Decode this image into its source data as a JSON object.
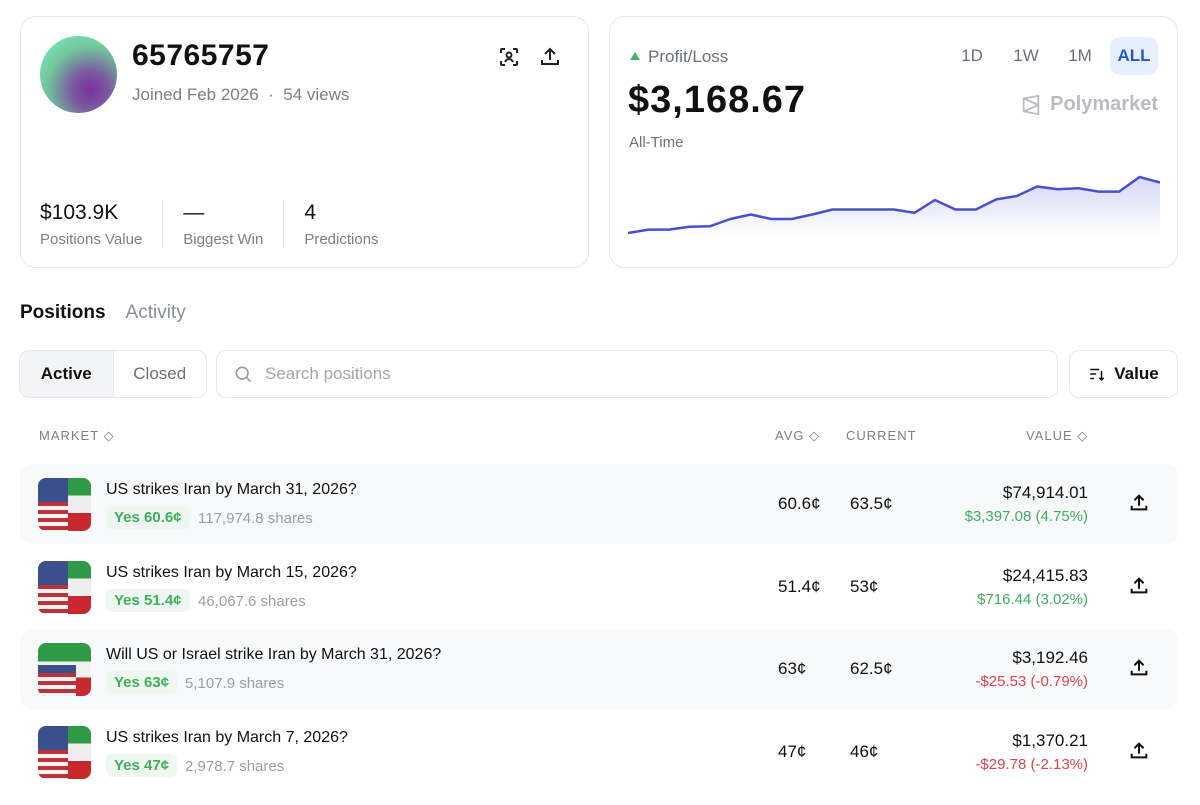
{
  "profile": {
    "username": "65765757",
    "joined": "Joined Feb 2026",
    "views": "54 views",
    "separator": "·",
    "stats": [
      {
        "value": "$103.9K",
        "label": "Positions Value"
      },
      {
        "value": "—",
        "label": "Biggest Win"
      },
      {
        "value": "4",
        "label": "Predictions"
      }
    ]
  },
  "pnl": {
    "label": "Profit/Loss",
    "value": "$3,168.67",
    "period": "All-Time",
    "ranges": [
      "1D",
      "1W",
      "1M",
      "ALL"
    ],
    "selected_range": "ALL",
    "brand": "Polymarket",
    "line_color": "#4a4fd0"
  },
  "chart_data": {
    "type": "area",
    "title": "Profit/Loss All-Time",
    "xlabel": "",
    "ylabel": "",
    "values": [
      0,
      6,
      6,
      11,
      12,
      25,
      33,
      25,
      25,
      33,
      42,
      42,
      42,
      42,
      36,
      59,
      42,
      42,
      60,
      66,
      83,
      78,
      80,
      74,
      74,
      100,
      90
    ]
  },
  "tabs": [
    "Positions",
    "Activity"
  ],
  "filter": {
    "segments": [
      "Active",
      "Closed"
    ],
    "search_placeholder": "Search positions",
    "sort_label": "Value"
  },
  "table": {
    "headers": {
      "market": "MARKET",
      "avg": "AVG",
      "current": "CURRENT",
      "value": "VALUE"
    },
    "rows": [
      {
        "title": "US strikes Iran by March 31, 2026?",
        "outcome": "Yes 60.6¢",
        "shares": "117,974.8 shares",
        "avg": "60.6¢",
        "current": "63.5¢",
        "value": "$74,914.01",
        "change": "$3,397.08 (4.75%)",
        "direction": "up",
        "flag": "us-iran"
      },
      {
        "title": "US strikes Iran by March 15, 2026?",
        "outcome": "Yes 51.4¢",
        "shares": "46,067.6 shares",
        "avg": "51.4¢",
        "current": "53¢",
        "value": "$24,415.83",
        "change": "$716.44 (3.02%)",
        "direction": "up",
        "flag": "us-iran"
      },
      {
        "title": "Will US or Israel strike Iran by March 31, 2026?",
        "outcome": "Yes 63¢",
        "shares": "5,107.9 shares",
        "avg": "63¢",
        "current": "62.5¢",
        "value": "$3,192.46",
        "change": "-$25.53 (-0.79%)",
        "direction": "down",
        "flag": "us-israel-iran"
      },
      {
        "title": "US strikes Iran by March 7, 2026?",
        "outcome": "Yes 47¢",
        "shares": "2,978.7 shares",
        "avg": "47¢",
        "current": "46¢",
        "value": "$1,370.21",
        "change": "-$29.78 (-2.13%)",
        "direction": "down",
        "flag": "us-iran"
      }
    ]
  }
}
